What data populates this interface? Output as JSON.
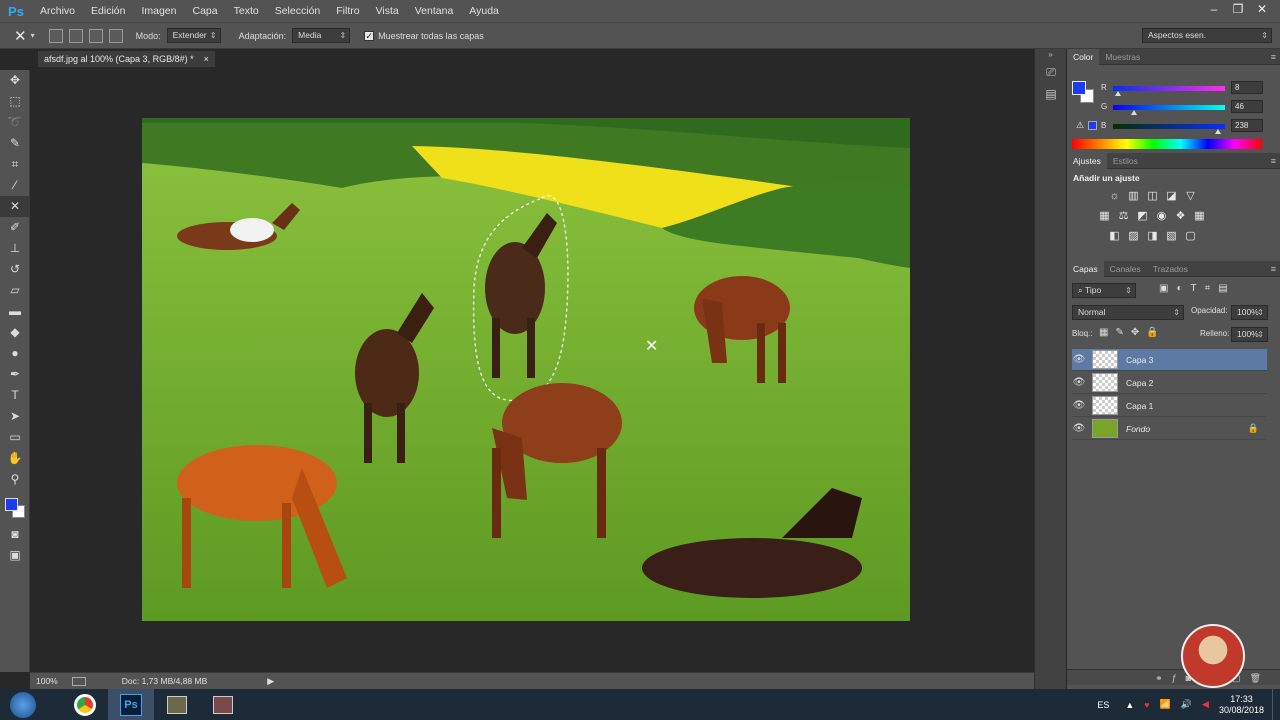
{
  "app": {
    "logo": "Ps"
  },
  "menu": [
    "Archivo",
    "Edición",
    "Imagen",
    "Capa",
    "Texto",
    "Selección",
    "Filtro",
    "Vista",
    "Ventana",
    "Ayuda"
  ],
  "window_controls": [
    "–",
    "❐",
    "✕"
  ],
  "options": {
    "mode_label": "Modo:",
    "mode_value": "Extender",
    "adapt_label": "Adaptación:",
    "adapt_value": "Media",
    "sample_all_label": "Muestrear todas las capas",
    "sample_all_checked": true,
    "workspace": "Aspectos esen."
  },
  "document": {
    "tab_title": "afsdf.jpg al 100% (Capa 3, RGB/8#) *",
    "tab_close": "×"
  },
  "status": {
    "zoom": "100%",
    "doc_info": "Doc: 1,73 MB/4,88 MB"
  },
  "color_panel": {
    "tabs": [
      "Color",
      "Muestras"
    ],
    "fg_color": "#1b3cf0",
    "r_label": "R",
    "r_value": "8",
    "g_label": "G",
    "g_value": "46",
    "b_label": "B",
    "b_value": "238"
  },
  "adjust_panel": {
    "tabs": [
      "Ajustes",
      "Estilos"
    ],
    "title": "Añadir un ajuste"
  },
  "layers_panel": {
    "tabs": [
      "Capas",
      "Canales",
      "Trazados"
    ],
    "filter_kind": "Tipo",
    "blend_mode": "Normal",
    "opacity_label": "Opacidad:",
    "opacity_value": "100%",
    "lock_label": "Bloq.:",
    "fill_label": "Relleno:",
    "fill_value": "100%",
    "layers": [
      {
        "name": "Capa 3",
        "selected": true
      },
      {
        "name": "Capa 2",
        "selected": false
      },
      {
        "name": "Capa 1",
        "selected": false
      },
      {
        "name": "Fondo",
        "selected": false,
        "locked": true
      }
    ]
  },
  "taskbar": {
    "language": "ES",
    "time": "17:33",
    "date": "30/08/2018"
  }
}
